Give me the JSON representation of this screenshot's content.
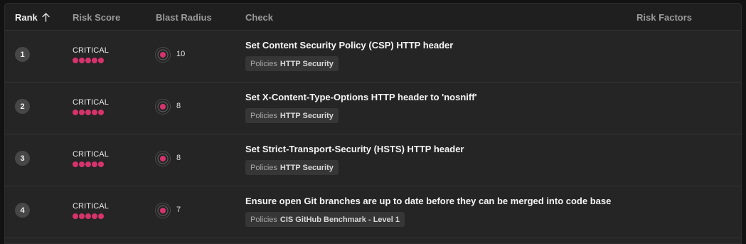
{
  "header": {
    "rank": "Rank",
    "risk_score": "Risk Score",
    "blast_radius": "Blast Radius",
    "check": "Check",
    "risk_factors": "Risk Factors",
    "sort_icon": "arrow-up-icon"
  },
  "colors": {
    "accent": "#d6336c",
    "background": "#252525",
    "header_background": "#1f1f1f"
  },
  "rows": [
    {
      "rank": "1",
      "risk": "CRITICAL",
      "risk_level": 5,
      "blast_radius": "10",
      "check": "Set Content Security Policy (CSP) HTTP header",
      "policy_prefix": "Policies",
      "policy": "HTTP Security"
    },
    {
      "rank": "2",
      "risk": "CRITICAL",
      "risk_level": 5,
      "blast_radius": "8",
      "check": "Set X-Content-Type-Options HTTP header to 'nosniff'",
      "policy_prefix": "Policies",
      "policy": "HTTP Security"
    },
    {
      "rank": "3",
      "risk": "CRITICAL",
      "risk_level": 5,
      "blast_radius": "8",
      "check": "Set Strict-Transport-Security (HSTS) HTTP header",
      "policy_prefix": "Policies",
      "policy": "HTTP Security"
    },
    {
      "rank": "4",
      "risk": "CRITICAL",
      "risk_level": 5,
      "blast_radius": "7",
      "check": "Ensure open Git branches are up to date before they can be merged into code base",
      "policy_prefix": "Policies",
      "policy": "CIS GitHub Benchmark - Level 1"
    }
  ]
}
